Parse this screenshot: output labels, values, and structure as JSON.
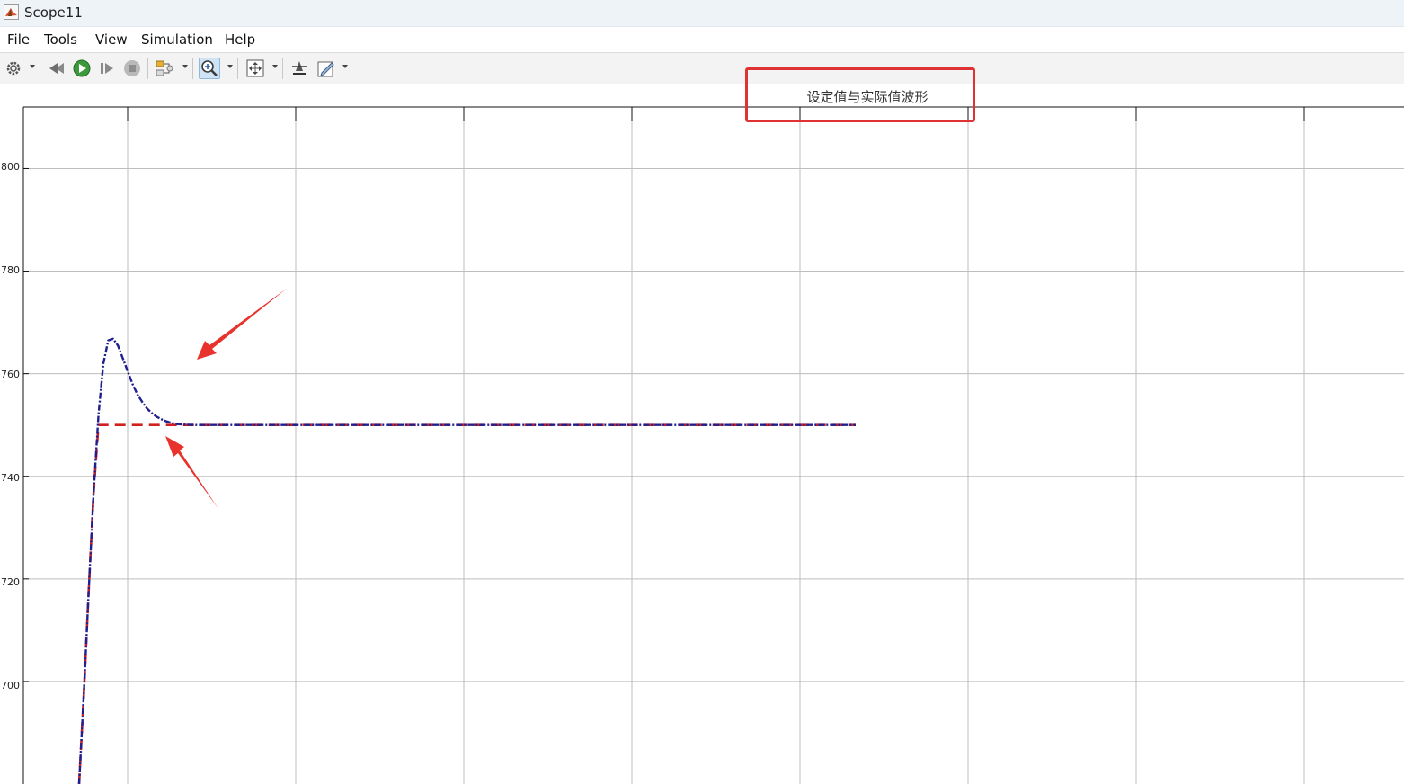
{
  "window": {
    "title": "Scope11"
  },
  "menu": {
    "items": [
      "File",
      "Tools",
      "View",
      "Simulation",
      "Help"
    ]
  },
  "toolbar": {
    "icons": [
      "settings-icon",
      "step-back-icon",
      "run-icon",
      "step-forward-icon",
      "stop-icon",
      "signal-selector-icon",
      "zoom-in-icon",
      "autoscale-icon",
      "highlight-icon",
      "edit-style-icon"
    ]
  },
  "plot": {
    "title": "设定值与实际值波形",
    "highlight_color": "#e03232"
  },
  "chart_data": {
    "type": "line",
    "title": "设定值与实际值波形",
    "ylim": [
      680,
      812
    ],
    "yticks": [
      700,
      720,
      740,
      760,
      780,
      800
    ],
    "ytick_labels": [
      "700",
      "720",
      "740",
      "760",
      "780",
      "800"
    ],
    "grid": true,
    "series": [
      {
        "color": "#1f1f8f",
        "style": "dash-dot",
        "x": [
          0.0,
          0.05,
          0.1,
          0.15,
          0.2,
          0.25,
          0.3,
          0.35,
          0.4,
          0.45,
          0.5,
          0.55,
          0.6,
          0.65,
          0.7,
          0.75,
          0.8,
          0.85,
          0.9,
          0.95,
          1.0,
          1.1,
          1.2,
          1.4,
          1.7,
          2.0,
          3.0,
          5.0,
          8.0
        ],
        "y": [
          680,
          698,
          718,
          737,
          752,
          762,
          766.5,
          766.8,
          765.5,
          763,
          760.5,
          758,
          756,
          754.5,
          753.2,
          752.3,
          751.6,
          751.1,
          750.7,
          750.4,
          750.2,
          750.05,
          750,
          750,
          750,
          750,
          750,
          750,
          750
        ]
      },
      {
        "color": "#d02020",
        "style": "dashed",
        "x": [
          0.0,
          0.05,
          0.1,
          0.15,
          0.2,
          0.25,
          0.3,
          1.0,
          8.0
        ],
        "y": [
          680,
          698,
          718,
          737,
          750,
          750,
          750,
          750,
          750
        ]
      }
    ],
    "annotations": [
      "red-arrow-to-overshoot",
      "red-arrow-to-setpoint"
    ]
  }
}
